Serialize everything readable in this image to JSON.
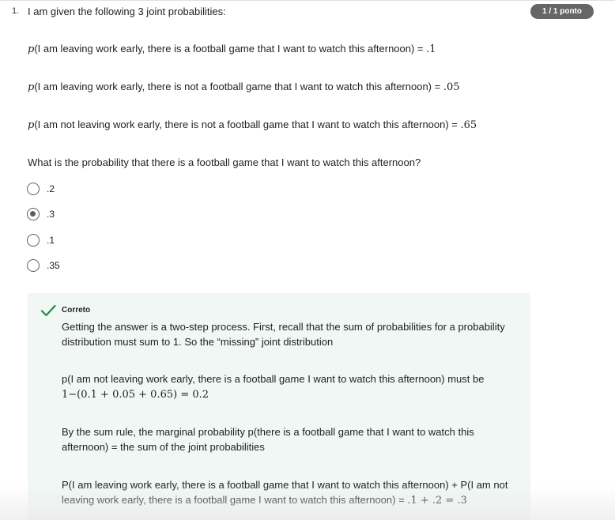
{
  "question": {
    "number": "1.",
    "title": "I am given the following 3 joint probabilities:",
    "score": "1 / 1 ponto",
    "prompt": "What is the probability that there is a football game that I want to watch this afternoon?"
  },
  "joint_probabilities": [
    {
      "p": "p",
      "text": "(I am leaving work early, there is a football game that I want to watch this afternoon) = ",
      "value": ".1"
    },
    {
      "p": "p",
      "text": "(I am leaving work early, there is not a football game that I want to watch this afternoon) = ",
      "value": ".05"
    },
    {
      "p": "p",
      "text": "(I am not leaving work early, there is not a football game that I want to watch this afternoon) = ",
      "value": ".65"
    }
  ],
  "options": [
    {
      "label": ".2",
      "selected": false
    },
    {
      "label": ".3",
      "selected": true
    },
    {
      "label": ".1",
      "selected": false
    },
    {
      "label": ".35",
      "selected": false
    }
  ],
  "feedback": {
    "status": "Correto",
    "icon": "check-icon",
    "color": "#1e8c45",
    "p1": "Getting the answer is a two-step process. First, recall that the sum of probabilities for a probability distribution must sum to 1. So the “missing” joint distribution",
    "p2_text": "p(I am not leaving work early, there is a football game I want to watch this afternoon) must be",
    "p2_math": "1−(0.1 + 0.05 + 0.65) = 0.2",
    "p3": "By the sum rule, the marginal probability p(there is a football game that I want to watch this afternoon) = the sum of the joint probabilities",
    "p4_text": "P(I am leaving work early, there is a football game that I want to watch this afternoon) + P(I am not leaving work early, there is a football game I want to watch this afternoon) = ",
    "p4_math": ".1 + .2 = .3"
  }
}
